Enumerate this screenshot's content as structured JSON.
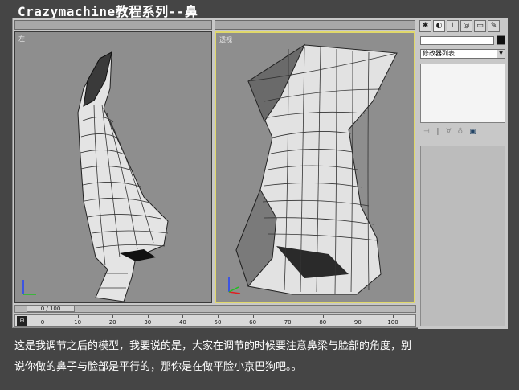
{
  "title": "Crazymachine教程系列--鼻",
  "viewports": {
    "left_label": "左",
    "persp_label": "透视"
  },
  "panel": {
    "tabs": [
      "arrow-icon",
      "modify-icon",
      "hierarchy-icon",
      "motion-icon",
      "display-icon",
      "utility-icon"
    ],
    "modifier_list": "修改器列表"
  },
  "timeline": {
    "slider_text": "0 / 100",
    "ticks": [
      "0",
      "10",
      "20",
      "30",
      "40",
      "50",
      "60",
      "70",
      "80",
      "90",
      "100"
    ]
  },
  "caption": {
    "line1": "这是我调节之后的模型，我要说的是，大家在调节的时候要注意鼻梁与脸部的角度，别",
    "line2": "说你做的鼻子与脸部是平行的，那你是在做平脸小京巴狗吧。。"
  },
  "colors": {
    "background": "#454545",
    "viewport": "#8e8e8e",
    "active_border": "#e0d86a"
  }
}
